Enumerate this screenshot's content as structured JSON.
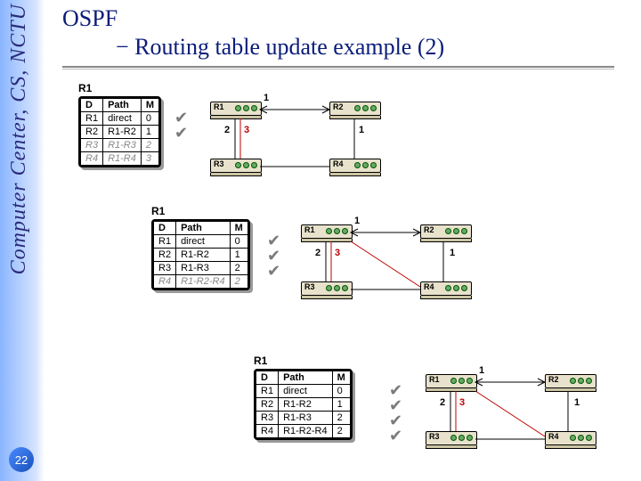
{
  "sidebar_text": "Computer Center, CS, NCTU",
  "page_number": "22",
  "title": "OSPF",
  "subtitle": "− Routing table update example (2)",
  "tables": {
    "t1": {
      "caption": "R1",
      "headers": [
        "D",
        "Path",
        "M"
      ],
      "rows": [
        {
          "c": [
            "R1",
            "direct",
            "0"
          ],
          "grey": false
        },
        {
          "c": [
            "R2",
            "R1-R2",
            "1"
          ],
          "grey": false
        },
        {
          "c": [
            "R3",
            "R1-R3",
            "2"
          ],
          "grey": true
        },
        {
          "c": [
            "R4",
            "R1-R4",
            "3"
          ],
          "grey": true
        }
      ]
    },
    "t2": {
      "caption": "R1",
      "headers": [
        "D",
        "Path",
        "M"
      ],
      "rows": [
        {
          "c": [
            "R1",
            "direct",
            "0"
          ],
          "grey": false
        },
        {
          "c": [
            "R2",
            "R1-R2",
            "1"
          ],
          "grey": false
        },
        {
          "c": [
            "R3",
            "R1-R3",
            "2"
          ],
          "grey": false
        },
        {
          "c": [
            "R4",
            "R1-R2-R4",
            "2"
          ],
          "grey": true
        }
      ]
    },
    "t3": {
      "caption": "R1",
      "headers": [
        "D",
        "Path",
        "M"
      ],
      "rows": [
        {
          "c": [
            "R1",
            "direct",
            "0"
          ],
          "grey": false
        },
        {
          "c": [
            "R2",
            "R1-R2",
            "1"
          ],
          "grey": false
        },
        {
          "c": [
            "R3",
            "R1-R3",
            "2"
          ],
          "grey": false
        },
        {
          "c": [
            "R4",
            "R1-R2-R4",
            "2"
          ],
          "grey": false
        }
      ]
    }
  },
  "routers": {
    "r1": "R1",
    "r2": "R2",
    "r3": "R3",
    "r4": "R4"
  },
  "weights": {
    "w_r1_r2": "1",
    "w_r1_r3_a": "2",
    "w_r1_r3_b": "3",
    "w_r2_r4": "1"
  },
  "chart_data": {
    "type": "diagram",
    "title": "OSPF Routing table update example (2)",
    "graph": {
      "nodes": [
        "R1",
        "R2",
        "R3",
        "R4"
      ],
      "edges": [
        {
          "u": "R1",
          "v": "R2",
          "w": 1
        },
        {
          "u": "R1",
          "v": "R3",
          "w": 2
        },
        {
          "u": "R1",
          "v": "R3",
          "w": 3,
          "alt": true
        },
        {
          "u": "R2",
          "v": "R4",
          "w": 1
        },
        {
          "u": "R3",
          "v": "R4",
          "w": null
        }
      ]
    },
    "steps": [
      {
        "step": 1,
        "confirmed_prev": [
          "R1",
          "R2"
        ],
        "routing_table_R1": [
          {
            "dest": "R1",
            "path": "direct",
            "metric": 0,
            "tentative": false
          },
          {
            "dest": "R2",
            "path": "R1-R2",
            "metric": 1,
            "tentative": false
          },
          {
            "dest": "R3",
            "path": "R1-R3",
            "metric": 2,
            "tentative": true
          },
          {
            "dest": "R4",
            "path": "R1-R4",
            "metric": 3,
            "tentative": true
          }
        ]
      },
      {
        "step": 2,
        "confirmed_prev": [
          "R1",
          "R2",
          "R3"
        ],
        "routing_table_R1": [
          {
            "dest": "R1",
            "path": "direct",
            "metric": 0,
            "tentative": false
          },
          {
            "dest": "R2",
            "path": "R1-R2",
            "metric": 1,
            "tentative": false
          },
          {
            "dest": "R3",
            "path": "R1-R3",
            "metric": 2,
            "tentative": false
          },
          {
            "dest": "R4",
            "path": "R1-R2-R4",
            "metric": 2,
            "tentative": true
          }
        ]
      },
      {
        "step": 3,
        "confirmed_prev": [
          "R1",
          "R2",
          "R3",
          "R4"
        ],
        "routing_table_R1": [
          {
            "dest": "R1",
            "path": "direct",
            "metric": 0,
            "tentative": false
          },
          {
            "dest": "R2",
            "path": "R1-R2",
            "metric": 1,
            "tentative": false
          },
          {
            "dest": "R3",
            "path": "R1-R3",
            "metric": 2,
            "tentative": false
          },
          {
            "dest": "R4",
            "path": "R1-R2-R4",
            "metric": 2,
            "tentative": false
          }
        ]
      }
    ]
  }
}
